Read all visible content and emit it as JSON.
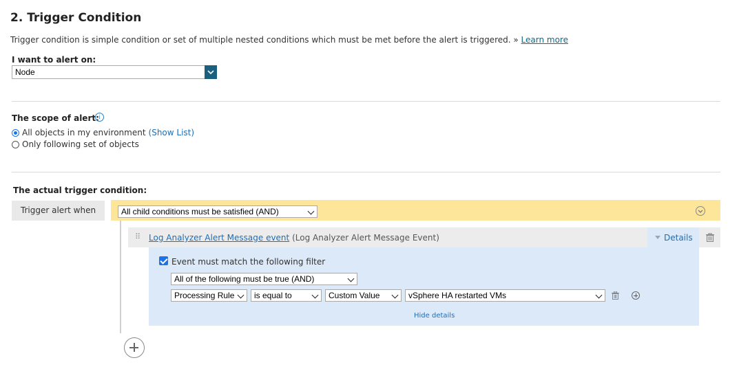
{
  "section": {
    "title": "2. Trigger Condition",
    "description": "Trigger condition is simple condition or set of multiple nested conditions which must be met before the alert is triggered. »",
    "learn_more": "Learn more"
  },
  "alert_on": {
    "label": "I want to alert on:",
    "value": "Node"
  },
  "scope": {
    "label": "The scope of alert:",
    "options": [
      {
        "label": "All objects in my environment",
        "link": "(Show List)",
        "selected": true
      },
      {
        "label": "Only following set of objects",
        "selected": false
      }
    ]
  },
  "trigger": {
    "heading": "The actual trigger condition:",
    "when_label": "Trigger alert when",
    "child_mode": "All child conditions must be satisfied (AND)",
    "condition": {
      "link": "Log Analyzer Alert Message event",
      "suffix": "(Log Analyzer Alert Message Event)",
      "details_label": "Details"
    },
    "filter": {
      "checkbox_label": "Event must match the following filter",
      "mode": "All of the following must be true (AND)",
      "field": "Processing Rule",
      "operator": "is equal to",
      "value_type": "Custom Value",
      "value": "vSphere HA restarted VMs",
      "hide_details": "Hide details"
    }
  }
}
